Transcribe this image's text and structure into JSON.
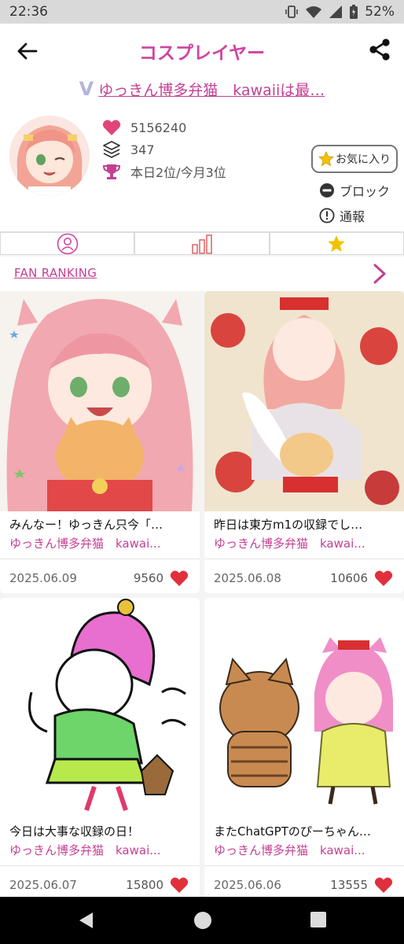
{
  "status_bar": {
    "time": "22:36",
    "battery": "52%",
    "icons": [
      "vibrate-icon",
      "wifi-icon",
      "signal-icon",
      "battery-icon"
    ]
  },
  "header": {
    "title": "コスプレイヤー",
    "back_icon": "arrow-left-icon",
    "share_icon": "share-icon"
  },
  "profile": {
    "name": "ゆっきん博多弁猫　kawaiiは最…",
    "badge": "V",
    "likes": "5156240",
    "posts": "347",
    "rank": "本日2位/今月3位",
    "favorite_label": "お気に入り",
    "block_label": "ブロック",
    "report_label": "通報"
  },
  "tabs": [
    {
      "icon": "person-icon"
    },
    {
      "icon": "bar-chart-icon"
    },
    {
      "icon": "star-icon"
    }
  ],
  "fan_ranking": {
    "label": "FAN RANKING"
  },
  "posts": [
    {
      "title": "みんなー！ゆっきん只今「…",
      "author": "ゆっきん博多弁猫　kawai...",
      "date": "2025.06.09",
      "likes": "9560"
    },
    {
      "title": "昨日は東方m1の収録でし…",
      "author": "ゆっきん博多弁猫　kawai...",
      "date": "2025.06.08",
      "likes": "10606"
    },
    {
      "title": "今日は大事な収録の日！",
      "author": "ゆっきん博多弁猫　kawai...",
      "date": "2025.06.07",
      "likes": "15800"
    },
    {
      "title": "またChatGPTのぴーちゃん…",
      "author": "ゆっきん博多弁猫　kawai...",
      "date": "2025.06.06",
      "likes": "13555"
    }
  ],
  "colors": {
    "accent": "#d1449f",
    "heart": "#e0303c",
    "star": "#f2c200",
    "trophy": "#c43f93"
  }
}
